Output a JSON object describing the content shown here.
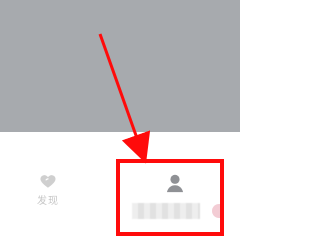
{
  "nav": {
    "left_tab_label": "发现",
    "left_tab_icon": "heart-icon",
    "right_tab_icon": "profile-icon",
    "right_tab_label": ""
  },
  "annotation": {
    "highlight_color": "#ff0b0b",
    "arrow_color": "#ff0b0b"
  }
}
